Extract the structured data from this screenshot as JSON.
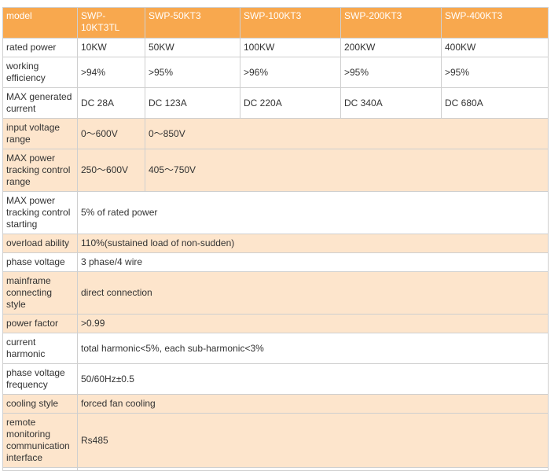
{
  "headers": [
    "model",
    "SWP-10KT3TL",
    "SWP-50KT3",
    "SWP-100KT3",
    "SWP-200KT3",
    "SWP-400KT3"
  ],
  "rows": {
    "rated_power": {
      "label": "rated power",
      "values": [
        "10KW",
        "50KW",
        "100KW",
        "200KW",
        "400KW"
      ]
    },
    "working_efficiency": {
      "label": "working efficiency",
      "values": [
        ">94%",
        ">95%",
        ">96%",
        ">95%",
        ">95%"
      ]
    },
    "max_current": {
      "label": "MAX generated current",
      "values": [
        "DC 28A",
        "DC 123A",
        "DC 220A",
        "DC 340A",
        "DC 680A"
      ]
    },
    "input_voltage": {
      "label": "input voltage range",
      "values": [
        "0～600V",
        "0～850V"
      ]
    },
    "mppt_range": {
      "label": "MAX power tracking control range",
      "values": [
        "250～600V",
        "405～750V"
      ]
    },
    "mppt_starting": {
      "label": "MAX power tracking control starting",
      "value": "5% of rated power"
    },
    "overload": {
      "label": "overload ability",
      "value": "110%(sustained load of non-sudden)"
    },
    "phase_voltage": {
      "label": "phase voltage",
      "value": "3 phase/4 wire"
    },
    "connecting_style": {
      "label": "mainframe connecting style",
      "value": "direct connection"
    },
    "power_factor": {
      "label": "power factor",
      "value": ">0.99"
    },
    "current_harmonic": {
      "label": "current harmonic",
      "value": "total harmonic<5%, each sub-harmonic<3%"
    },
    "phase_freq": {
      "label": "phase voltage frequency",
      "value": "50/60Hz±0.5"
    },
    "cooling": {
      "label": "cooling style",
      "value": "forced fan cooling"
    },
    "remote": {
      "label": "remote monitoring communication interface",
      "value": "Rs485"
    }
  },
  "colors": {
    "header_bg": "#f8a84e",
    "shaded_row": "#fde5cc",
    "border": "#cfcfcf"
  }
}
